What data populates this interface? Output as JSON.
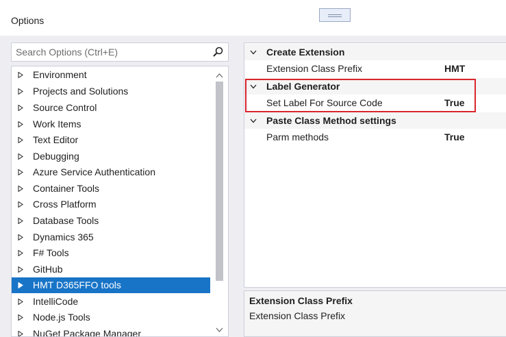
{
  "window": {
    "title": "Options"
  },
  "search": {
    "placeholder": "Search Options (Ctrl+E)"
  },
  "tree": {
    "items": [
      {
        "label": "Environment"
      },
      {
        "label": "Projects and Solutions"
      },
      {
        "label": "Source Control"
      },
      {
        "label": "Work Items"
      },
      {
        "label": "Text Editor"
      },
      {
        "label": "Debugging"
      },
      {
        "label": "Azure Service Authentication"
      },
      {
        "label": "Container Tools"
      },
      {
        "label": "Cross Platform"
      },
      {
        "label": "Database Tools"
      },
      {
        "label": "Dynamics 365"
      },
      {
        "label": "F# Tools"
      },
      {
        "label": "GitHub"
      },
      {
        "label": "HMT D365FFO tools"
      },
      {
        "label": "IntelliCode"
      },
      {
        "label": "Node.js Tools"
      },
      {
        "label": "NuGet Package Manager"
      }
    ],
    "selected_index": 13
  },
  "property_grid": {
    "categories": [
      {
        "label": "Create Extension",
        "properties": [
          {
            "name": "Extension Class Prefix",
            "value": "HMT"
          }
        ]
      },
      {
        "label": "Label Generator",
        "properties": [
          {
            "name": "Set Label For Source Code",
            "value": "True"
          }
        ]
      },
      {
        "label": "Paste Class Method settings",
        "properties": [
          {
            "name": "Parm methods",
            "value": "True"
          }
        ]
      }
    ]
  },
  "description": {
    "title": "Extension Class Prefix",
    "text": "Extension Class Prefix"
  },
  "colors": {
    "selection": "#1874c7",
    "highlight_box": "#d9252c",
    "panel_border": "#cccedb",
    "background_band": "#eeeef2"
  }
}
